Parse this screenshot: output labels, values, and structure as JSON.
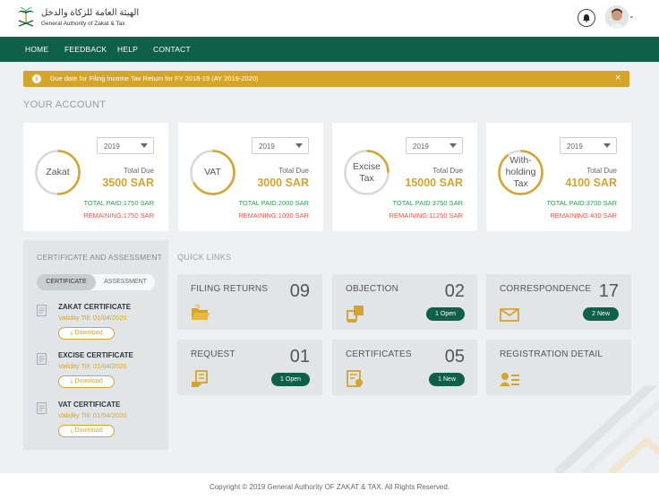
{
  "header": {
    "logo_arabic": "الهيئة العامة للزكاة والدخل",
    "logo_english": "General Authority of Zakat & Tax",
    "icons": [
      "logo-palm-icon",
      "bell-icon",
      "avatar",
      "chevron-down-icon"
    ]
  },
  "nav": {
    "items": [
      {
        "label": "HOME"
      },
      {
        "label": "FEEDBACK"
      },
      {
        "label": "HELP"
      },
      {
        "label": "CONTACT"
      }
    ]
  },
  "alert": {
    "text": "Due date for Filing Income Tax Return for FY 2018-19 (AY 2019-2020)",
    "info_icon": "i",
    "close_icon": "×"
  },
  "account": {
    "title": "YOUR ACCOUNT",
    "cards": [
      {
        "name": "Zakat",
        "year": "2019",
        "due_label": "Total Due",
        "due": "3500 SAR",
        "paid": "TOTAL PAID:1750 SAR",
        "remaining": "REMAINING:1750 SAR",
        "paid_fraction": 0.5
      },
      {
        "name": "VAT",
        "year": "2019",
        "due_label": "Total Due",
        "due": "3000 SAR",
        "paid": "TOTAL PAID:2000 SAR",
        "remaining": "REMAINING:1000 SAR",
        "paid_fraction": 0.67
      },
      {
        "name": "Excise Tax",
        "year": "2019",
        "due_label": "Total Due",
        "due": "15000 SAR",
        "paid": "TOTAL PAID:3750 SAR",
        "remaining": "REMAINING:11250 SAR",
        "paid_fraction": 0.25
      },
      {
        "name": "With-holding Tax",
        "year": "2019",
        "due_label": "Total Due",
        "due": "4100 SAR",
        "paid": "TOTAL PAID:3700 SAR",
        "remaining": "REMAINING:400 SAR",
        "paid_fraction": 0.9
      }
    ]
  },
  "certificates": {
    "title": "CERTIFICATE AND ASSESSMENT",
    "tabs": [
      "CERTIFICATE",
      "ASSESSMENT"
    ],
    "download_label": "Download",
    "items": [
      {
        "name": "ZAKAT CERTIFICATE",
        "validity": "Validity Till: 01/04/2020"
      },
      {
        "name": "EXCISE CERTIFICATE",
        "validity": "Validity Till: 01/04/2020"
      },
      {
        "name": "VAT CERTIFICATE",
        "validity": "Validity Till: 01/04/2020"
      }
    ]
  },
  "quick_links": {
    "title": "QUICK LINKS",
    "tiles": [
      {
        "title": "FILING RETURNS",
        "count": "09",
        "badge": "",
        "icon": "folder-icon"
      },
      {
        "title": "OBJECTION",
        "count": "02",
        "badge": "1 Open",
        "icon": "objection-icon"
      },
      {
        "title": "CORRESPONDENCE",
        "count": "17",
        "badge": "2 New",
        "icon": "mail-icon"
      },
      {
        "title": "REQUEST",
        "count": "01",
        "badge": "1 Open",
        "icon": "request-icon"
      },
      {
        "title": "CERTIFICATES",
        "count": "05",
        "badge": "1 New",
        "icon": "certificate-icon"
      },
      {
        "title": "REGISTRATION DETAIL",
        "count": "",
        "badge": "",
        "icon": "registration-icon"
      }
    ]
  },
  "footer": {
    "text": "Copyright © 2019 General Authority OF ZAKAT & TAX. All Rights Reserved."
  },
  "colors": {
    "brand_green": "#0f6048",
    "accent_gold": "#d4a52a",
    "paid_green": "#2e9c56",
    "remaining_red": "#e05a4a",
    "ring_gray": "#d6d8da"
  }
}
